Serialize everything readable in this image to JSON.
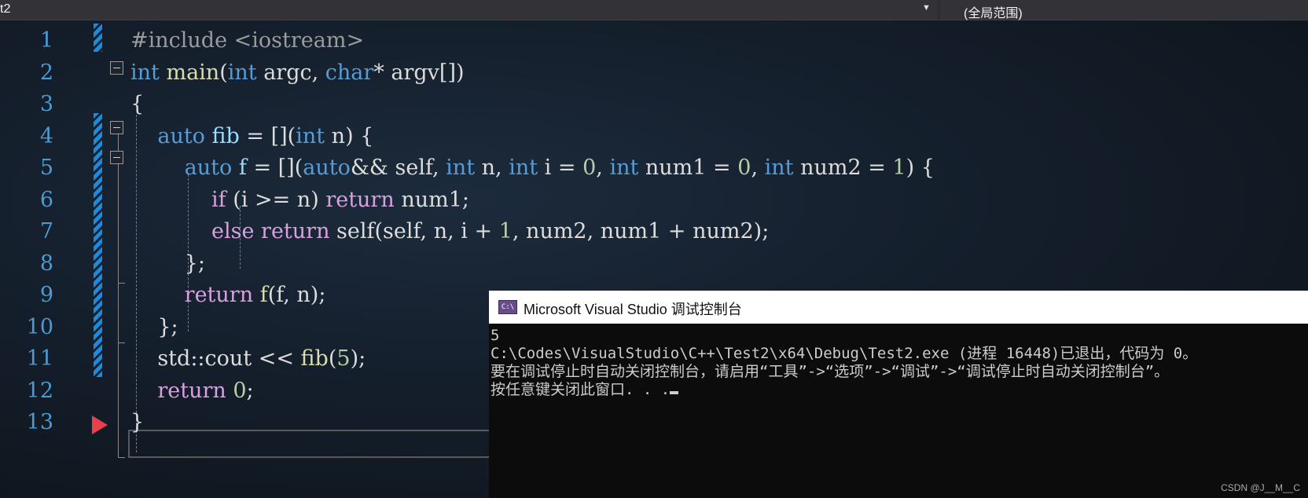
{
  "nav": {
    "file_dropdown": "t2",
    "scope_dropdown": "(全局范围)"
  },
  "editor": {
    "line_numbers": [
      "1",
      "2",
      "3",
      "4",
      "5",
      "6",
      "7",
      "8",
      "9",
      "10",
      "11",
      "12",
      "13"
    ],
    "lines": [
      [
        {
          "t": "#include <iostream>",
          "c": "pp"
        }
      ],
      [
        {
          "t": "int",
          "c": "kw"
        },
        {
          "t": " "
        },
        {
          "t": "main",
          "c": "fn"
        },
        {
          "t": "("
        },
        {
          "t": "int",
          "c": "kw"
        },
        {
          "t": " argc, "
        },
        {
          "t": "char",
          "c": "kw"
        },
        {
          "t": "* argv[])"
        }
      ],
      [
        {
          "t": "{"
        }
      ],
      [
        {
          "t": "    "
        },
        {
          "t": "auto",
          "c": "kw"
        },
        {
          "t": " "
        },
        {
          "t": "fib",
          "c": "id"
        },
        {
          "t": " = []("
        },
        {
          "t": "int",
          "c": "kw"
        },
        {
          "t": " n) {"
        }
      ],
      [
        {
          "t": "        "
        },
        {
          "t": "auto",
          "c": "kw"
        },
        {
          "t": " "
        },
        {
          "t": "f",
          "c": "id"
        },
        {
          "t": " = []("
        },
        {
          "t": "auto",
          "c": "kw"
        },
        {
          "t": "&& self, "
        },
        {
          "t": "int",
          "c": "kw"
        },
        {
          "t": " n, "
        },
        {
          "t": "int",
          "c": "kw"
        },
        {
          "t": " i = "
        },
        {
          "t": "0",
          "c": "num"
        },
        {
          "t": ", "
        },
        {
          "t": "int",
          "c": "kw"
        },
        {
          "t": " num1 = "
        },
        {
          "t": "0",
          "c": "num"
        },
        {
          "t": ", "
        },
        {
          "t": "int",
          "c": "kw"
        },
        {
          "t": " num2 = "
        },
        {
          "t": "1",
          "c": "num"
        },
        {
          "t": ") {"
        }
      ],
      [
        {
          "t": "            "
        },
        {
          "t": "if",
          "c": "ctl"
        },
        {
          "t": " (i >= n) "
        },
        {
          "t": "return",
          "c": "ctl"
        },
        {
          "t": " num1;"
        }
      ],
      [
        {
          "t": "            "
        },
        {
          "t": "else",
          "c": "ctl"
        },
        {
          "t": " "
        },
        {
          "t": "return",
          "c": "ctl"
        },
        {
          "t": " self(self, n, i + "
        },
        {
          "t": "1",
          "c": "num"
        },
        {
          "t": ", num2, num1 + num2);"
        }
      ],
      [
        {
          "t": "        };"
        }
      ],
      [
        {
          "t": "        "
        },
        {
          "t": "return",
          "c": "ctl"
        },
        {
          "t": " "
        },
        {
          "t": "f",
          "c": "fn"
        },
        {
          "t": "(f, n);"
        }
      ],
      [
        {
          "t": "    };"
        }
      ],
      [
        {
          "t": "    std::cout << "
        },
        {
          "t": "fib",
          "c": "fn"
        },
        {
          "t": "("
        },
        {
          "t": "5",
          "c": "num"
        },
        {
          "t": ");"
        }
      ],
      [
        {
          "t": "    "
        },
        {
          "t": "return",
          "c": "ctl"
        },
        {
          "t": " "
        },
        {
          "t": "0",
          "c": "num"
        },
        {
          "t": ";"
        }
      ],
      [
        {
          "t": "}"
        }
      ]
    ]
  },
  "console": {
    "icon_text": "C:\\",
    "title": "Microsoft Visual Studio 调试控制台",
    "line1": "5",
    "line2": "C:\\Codes\\VisualStudio\\C++\\Test2\\x64\\Debug\\Test2.exe (进程 16448)已退出，代码为 0。",
    "line3": "要在调试停止时自动关闭控制台，请启用“工具”->“选项”->“调试”->“调试停止时自动关闭控制台”。",
    "line4": "按任意键关闭此窗口. . ."
  },
  "watermark": "CSDN @J__M__C",
  "colors": {
    "line_number": "#4a9ad4",
    "keyword": "#569cd6",
    "control": "#d8a0df",
    "function": "#dcdcaa",
    "number": "#b5cea8",
    "change_marker": "#1f8ad8",
    "execution_arrow": "#e8404a"
  }
}
